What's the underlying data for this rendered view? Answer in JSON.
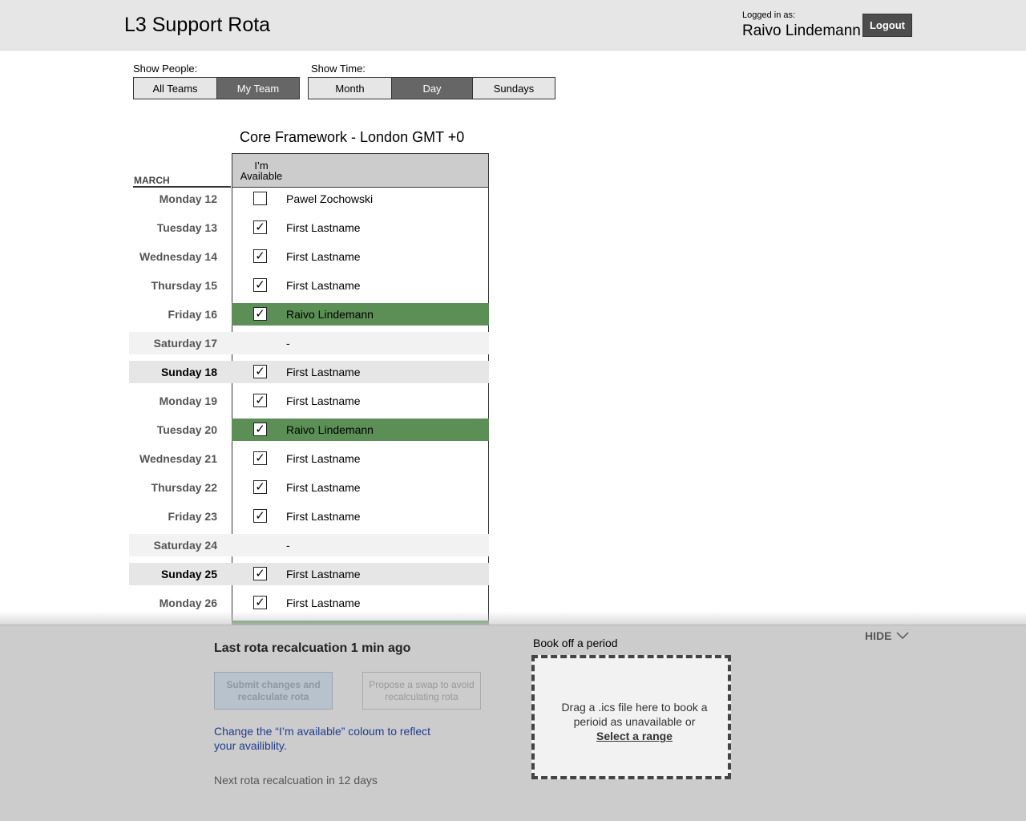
{
  "header": {
    "title": "L3 Support Rota",
    "logged_in_label": "Logged in as:",
    "user_name": "Raivo Lindemann",
    "logout_label": "Logout"
  },
  "filters": {
    "people_label": "Show People:",
    "people_options": [
      "All Teams",
      "My Team"
    ],
    "people_selected": "My Team",
    "time_label": "Show Time:",
    "time_options": [
      "Month",
      "Day",
      "Sundays"
    ],
    "time_selected": "Day"
  },
  "rota": {
    "team_title": "Core Framework - London GMT +0",
    "month": "MARCH",
    "available_header": "I’m Available",
    "rows": [
      {
        "day": "Monday 12",
        "kind": "weekday",
        "checked": false,
        "name": "Pawel Zochowski",
        "mine": false
      },
      {
        "day": "Tuesday 13",
        "kind": "weekday",
        "checked": true,
        "name": "First Lastname",
        "mine": false
      },
      {
        "day": "Wednesday 14",
        "kind": "weekday",
        "checked": true,
        "name": "First Lastname",
        "mine": false
      },
      {
        "day": "Thursday 15",
        "kind": "weekday",
        "checked": true,
        "name": "First Lastname",
        "mine": false
      },
      {
        "day": "Friday 16",
        "kind": "weekday",
        "checked": true,
        "name": "Raivo Lindemann",
        "mine": true
      },
      {
        "day": "Saturday 17",
        "kind": "saturday",
        "checked": null,
        "name": "-",
        "mine": false
      },
      {
        "day": "Sunday 18",
        "kind": "sunday",
        "checked": true,
        "name": "First Lastname",
        "mine": false
      },
      {
        "day": "Monday 19",
        "kind": "weekday",
        "checked": true,
        "name": "First Lastname",
        "mine": false
      },
      {
        "day": "Tuesday 20",
        "kind": "weekday",
        "checked": true,
        "name": "Raivo Lindemann",
        "mine": true
      },
      {
        "day": "Wednesday 21",
        "kind": "weekday",
        "checked": true,
        "name": "First Lastname",
        "mine": false
      },
      {
        "day": "Thursday 22",
        "kind": "weekday",
        "checked": true,
        "name": "First Lastname",
        "mine": false
      },
      {
        "day": "Friday 23",
        "kind": "weekday",
        "checked": true,
        "name": "First Lastname",
        "mine": false
      },
      {
        "day": "Saturday 24",
        "kind": "saturday",
        "checked": null,
        "name": "-",
        "mine": false
      },
      {
        "day": "Sunday 25",
        "kind": "sunday",
        "checked": true,
        "name": "First Lastname",
        "mine": false
      },
      {
        "day": "Monday 26",
        "kind": "weekday",
        "checked": true,
        "name": "First Lastname",
        "mine": false
      },
      {
        "day": "",
        "kind": "weekday",
        "checked": null,
        "name": "",
        "mine": true
      }
    ]
  },
  "panel": {
    "recalc_title": "Last rota recalcuation 1 min ago",
    "submit_label": "Submit changes and recalculate rota",
    "propose_label": "Propose a swap to avoid recalculating rota",
    "hint": "Change the “I’m available” coloum to reflect your availiblity.",
    "next_recalc": "Next rota recalcuation in 12 days",
    "book_title": "Book off a period",
    "drop_text": "Drag a .ics file here to book a perioid as unavailable or",
    "select_range_label": "Select a range",
    "hide_label": "HIDE"
  },
  "colors": {
    "mine_row": "#5b8f55",
    "header_bg": "#e6e6e6",
    "panel_bg": "#cccccc",
    "hint_text": "#1f3d8f"
  }
}
